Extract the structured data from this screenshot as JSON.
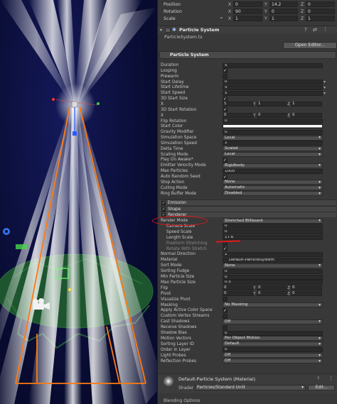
{
  "transform": {
    "position": {
      "label": "Position",
      "x": "0",
      "y": "14.2",
      "z": "0"
    },
    "rotation": {
      "label": "Rotation",
      "x": "90",
      "y": "0",
      "z": "0"
    },
    "scale": {
      "label": "Scale",
      "x": "1",
      "y": "1",
      "z": "1"
    }
  },
  "component": {
    "title": "Particle System",
    "script": "ParticleSystem.ts",
    "open_editor": "Open Editor..."
  },
  "module": {
    "title": "Particle System"
  },
  "props": [
    {
      "label": "Duration",
      "kind": "field",
      "value": "5"
    },
    {
      "label": "Looping",
      "kind": "check",
      "value": "✓"
    },
    {
      "label": "Prewarm",
      "kind": "check",
      "value": ""
    },
    {
      "label": "Start Delay",
      "kind": "field",
      "value": "0"
    },
    {
      "label": "Start Lifetime",
      "kind": "field",
      "value": "5"
    },
    {
      "label": "Start Speed",
      "kind": "field",
      "value": "5"
    },
    {
      "label": "3D Start Size",
      "kind": "check",
      "value": "✓"
    },
    {
      "label": "X",
      "kind": "vec",
      "values": [
        "1",
        "1",
        "1"
      ]
    },
    {
      "label": "3D Start Rotation",
      "kind": "check",
      "value": "✓"
    },
    {
      "label": "X",
      "kind": "vec",
      "values": [
        "0",
        "0",
        "0"
      ]
    },
    {
      "label": "Flip Rotation",
      "kind": "field",
      "value": "0"
    },
    {
      "label": "Start Color",
      "kind": "color",
      "value": "#ffffff"
    },
    {
      "label": "Gravity Modifier",
      "kind": "field",
      "value": "0"
    },
    {
      "label": "Simulation Space",
      "kind": "drop",
      "value": "Local"
    },
    {
      "label": "Simulation Speed",
      "kind": "field",
      "value": "1"
    },
    {
      "label": "Delta Time",
      "kind": "drop",
      "value": "Scaled"
    },
    {
      "label": "Scaling Mode",
      "kind": "drop",
      "value": "Local"
    },
    {
      "label": "Play On Awake*",
      "kind": "check",
      "value": "✓"
    },
    {
      "label": "Emitter Velocity Mode",
      "kind": "drop",
      "value": "Rigidbody"
    },
    {
      "label": "Max Particles",
      "kind": "field",
      "value": "1000"
    },
    {
      "label": "Auto Random Seed",
      "kind": "check",
      "value": "✓"
    },
    {
      "label": "Stop Action",
      "kind": "drop",
      "value": "None"
    },
    {
      "label": "Culling Mode",
      "kind": "drop",
      "value": "Automatic"
    },
    {
      "label": "Ring Buffer Mode",
      "kind": "drop",
      "value": "Disabled"
    }
  ],
  "submodules": [
    {
      "label": "Emission",
      "checked": "✓"
    },
    {
      "label": "Shape",
      "checked": "✓"
    },
    {
      "label": "Renderer",
      "checked": "✓"
    }
  ],
  "renderer_props": [
    {
      "label": "Render Mode",
      "kind": "drop",
      "value": "Stretched Billboard"
    },
    {
      "label": "Camera Scale",
      "kind": "field",
      "value": "0",
      "indent": true
    },
    {
      "label": "Speed Scale",
      "kind": "field",
      "value": "0",
      "indent": true
    },
    {
      "label": "Length Scale",
      "kind": "field",
      "value": "17.6",
      "indent": true
    },
    {
      "label": "Freeform Stretching",
      "kind": "check",
      "value": "",
      "indent": true,
      "dim": true
    },
    {
      "label": "Rotate With Stretch",
      "kind": "check",
      "value": "✓",
      "indent": true,
      "dim": true
    },
    {
      "label": "Normal Direction",
      "kind": "field",
      "value": "1"
    },
    {
      "label": "Material",
      "kind": "object",
      "value": "Default-ParticleSystem"
    },
    {
      "label": "Sort Mode",
      "kind": "drop",
      "value": "None"
    },
    {
      "label": "Sorting Fudge",
      "kind": "field",
      "value": "0"
    },
    {
      "label": "Min Particle Size",
      "kind": "field",
      "value": "0"
    },
    {
      "label": "Max Particle Size",
      "kind": "field",
      "value": "0.5"
    },
    {
      "label": "Flip",
      "kind": "vec",
      "values": [
        "0",
        "0",
        "0"
      ]
    },
    {
      "label": "Pivot",
      "kind": "vec",
      "values": [
        "0",
        "0",
        "0"
      ]
    },
    {
      "label": "Visualize Pivot",
      "kind": "check",
      "value": ""
    },
    {
      "label": "Masking",
      "kind": "drop",
      "value": "No Masking"
    },
    {
      "label": "Apply Active Color Space",
      "kind": "check",
      "value": "✓"
    },
    {
      "label": "Custom Vertex Streams",
      "kind": "check",
      "value": ""
    },
    {
      "label": "Cast Shadows",
      "kind": "drop",
      "value": "Off"
    },
    {
      "label": "Receive Shadows",
      "kind": "check",
      "value": ""
    },
    {
      "label": "Shadow Bias",
      "kind": "field",
      "value": "0"
    },
    {
      "label": "Motion Vectors",
      "kind": "drop",
      "value": "Per Object Motion"
    },
    {
      "label": "Sorting Layer ID",
      "kind": "drop",
      "value": "Default"
    },
    {
      "label": "Order in Layer",
      "kind": "field",
      "value": "0"
    },
    {
      "label": "Light Probes",
      "kind": "drop",
      "value": "Off"
    },
    {
      "label": "Reflection Probes",
      "kind": "drop",
      "value": "Off"
    }
  ],
  "material": {
    "title": "Default-Particle System (Material)",
    "shader_label": "Shader",
    "shader_value": "Particles/Standard Unlit",
    "edit": "Edit..."
  },
  "blending": "Blending Options"
}
